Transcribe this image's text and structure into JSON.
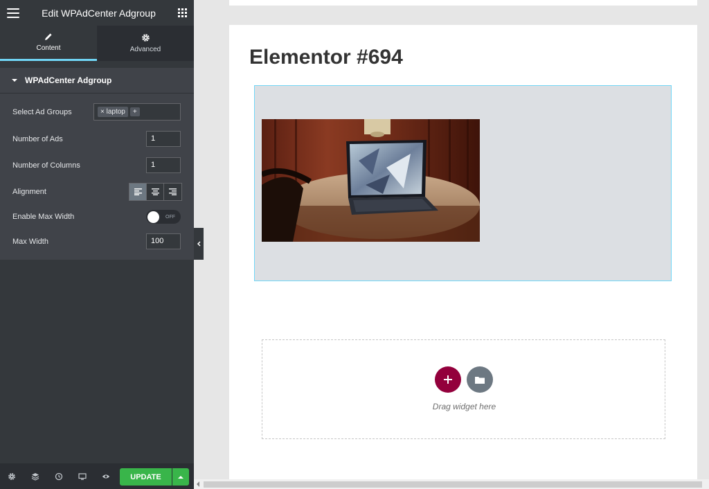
{
  "header": {
    "title": "Edit WPAdCenter Adgroup"
  },
  "tabs": [
    {
      "label": "Content",
      "icon": "pencil-icon"
    },
    {
      "label": "Advanced",
      "icon": "gear-icon"
    }
  ],
  "section": {
    "title": "WPAdCenter Adgroup",
    "controls": {
      "ad_groups": {
        "label": "Select Ad Groups",
        "tags": [
          "laptop"
        ],
        "add": "+"
      },
      "num_ads": {
        "label": "Number of Ads",
        "value": "1"
      },
      "num_columns": {
        "label": "Number of Columns",
        "value": "1"
      },
      "alignment": {
        "label": "Alignment",
        "selected": "left"
      },
      "enable_max_width": {
        "label": "Enable Max Width",
        "state": "OFF"
      },
      "max_width": {
        "label": "Max Width",
        "value": "100"
      }
    }
  },
  "footer": {
    "update_label": "UPDATE"
  },
  "preview": {
    "page_title": "Elementor #694",
    "drag_text": "Drag widget here"
  },
  "colors": {
    "accent": "#71d7f7",
    "update": "#39b54a",
    "add_button": "#93003c"
  }
}
